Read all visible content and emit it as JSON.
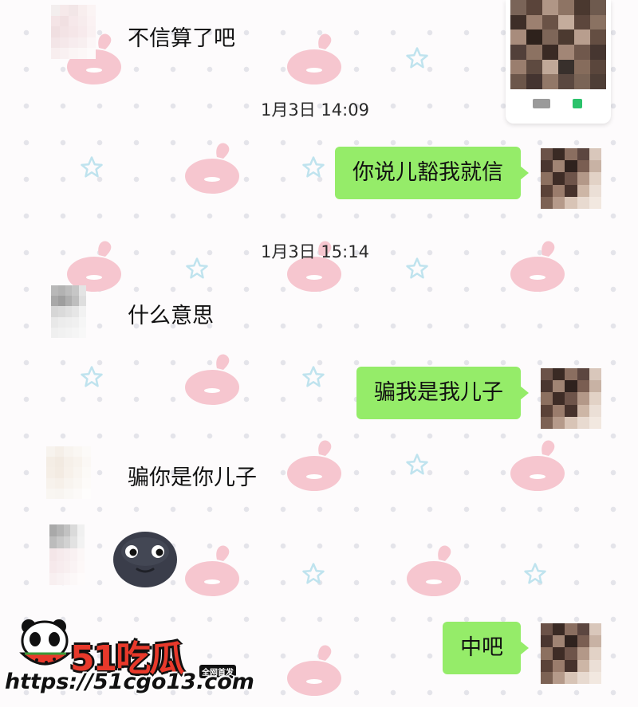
{
  "chat": {
    "messages": [
      {
        "side": "left",
        "type": "text",
        "text": "不信算了吧"
      },
      {
        "type": "time",
        "text": "1月3日 14:09"
      },
      {
        "side": "right",
        "type": "text",
        "text": "你说儿豁我就信"
      },
      {
        "type": "time",
        "text": "1月3日 15:14"
      },
      {
        "side": "left",
        "type": "text",
        "text": "什么意思"
      },
      {
        "side": "right",
        "type": "text",
        "text": "骗我是我儿子"
      },
      {
        "side": "left",
        "type": "text",
        "text": "骗你是你儿子"
      },
      {
        "side": "left",
        "type": "sticker",
        "sticker": "dark-round-face-sticker"
      },
      {
        "side": "right",
        "type": "text",
        "text": "中吧"
      }
    ]
  },
  "watermark": {
    "logo_text": "51吃瓜",
    "tag": "全网首发",
    "url": "https://51cgo13.com"
  },
  "colors": {
    "bubble_green": "#95ec69",
    "background": "#fdfbfc",
    "bunny_pink": "#f6c6cf",
    "star_blue": "#bfe3ee"
  }
}
